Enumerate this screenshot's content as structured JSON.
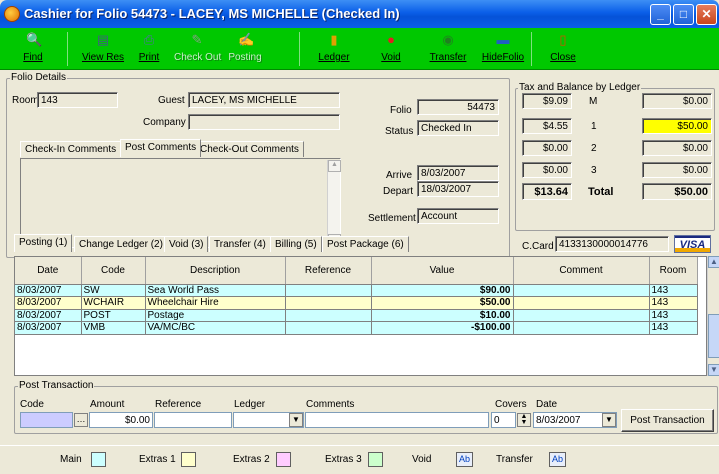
{
  "window": {
    "title": "Cashier for Folio 54473 - LACEY, MS MICHELLE (Checked In)"
  },
  "toolbar": {
    "find": "Find",
    "view_res": "View Res",
    "print": "Print",
    "check_out": "Check Out",
    "posting": "Posting",
    "ledger": "Ledger",
    "void": "Void",
    "transfer": "Transfer",
    "hide_folio": "HideFolio",
    "close": "Close"
  },
  "folio_details": {
    "group_title": "Folio Details",
    "room_label": "Room",
    "room": "143",
    "guest_label": "Guest",
    "guest": "LACEY, MS MICHELLE",
    "company_label": "Company",
    "company": "",
    "folio_label": "Folio",
    "folio": "54473",
    "status_label": "Status",
    "status": "Checked In",
    "arrive_label": "Arrive",
    "arrive": "8/03/2007",
    "depart_label": "Depart",
    "depart": "18/03/2007",
    "settlement_label": "Settlement",
    "settlement": "Account",
    "ccard_label": "C.Card",
    "ccard": "4133130000014776",
    "card_brand": "VISA"
  },
  "comment_tabs": [
    "Check-In Comments",
    "Post Comments",
    "Check-Out Comments"
  ],
  "tax_balance": {
    "group_title": "Tax and Balance by Ledger",
    "rows": [
      {
        "tax": "$9.09",
        "ledger": "M",
        "balance": "$0.00"
      },
      {
        "tax": "$4.55",
        "ledger": "1",
        "balance": "$50.00"
      },
      {
        "tax": "$0.00",
        "ledger": "2",
        "balance": "$0.00"
      },
      {
        "tax": "$0.00",
        "ledger": "3",
        "balance": "$0.00"
      }
    ],
    "total_tax": "$13.64",
    "total_label": "Total",
    "total_balance": "$50.00"
  },
  "main_tabs": [
    "Posting (1)",
    "Change Ledger (2)",
    "Void (3)",
    "Transfer (4)",
    "Billing (5)",
    "Post Package (6)"
  ],
  "grid": {
    "columns": [
      "Date",
      "Code",
      "Description",
      "Reference",
      "Value",
      "Comment",
      "Room"
    ],
    "rows": [
      {
        "date": "8/03/2007",
        "code": "SW",
        "description": "Sea World Pass",
        "reference": "",
        "value": "$90.00",
        "comment": "",
        "room": "143"
      },
      {
        "date": "8/03/2007",
        "code": "WCHAIR",
        "description": "Wheelchair Hire",
        "reference": "",
        "value": "$50.00",
        "comment": "",
        "room": "143"
      },
      {
        "date": "8/03/2007",
        "code": "POST",
        "description": "Postage",
        "reference": "",
        "value": "$10.00",
        "comment": "",
        "room": "143"
      },
      {
        "date": "8/03/2007",
        "code": "VMB",
        "description": "VA/MC/BC",
        "reference": "",
        "value": "-$100.00",
        "comment": "",
        "room": "143"
      }
    ]
  },
  "post_transaction": {
    "group_title": "Post Transaction",
    "code_label": "Code",
    "code": "",
    "amount_label": "Amount",
    "amount": "$0.00",
    "reference_label": "Reference",
    "reference": "",
    "ledger_label": "Ledger",
    "ledger": "",
    "comments_label": "Comments",
    "comments": "",
    "covers_label": "Covers",
    "covers": "0",
    "date_label": "Date",
    "date": "8/03/2007",
    "button": "Post Transaction"
  },
  "legend": {
    "main": "Main",
    "extras1": "Extras 1",
    "extras2": "Extras 2",
    "extras3": "Extras 3",
    "void": "Void",
    "transfer": "Transfer",
    "ab": "Ab"
  },
  "colors": {
    "toolbar": "#00c800",
    "main_row": "#ccffff",
    "extras1_row": "#ffffcc",
    "extras2_row": "#ffccff",
    "extras3_row": "#ccffcc",
    "balance_highlight": "#ffff00"
  }
}
